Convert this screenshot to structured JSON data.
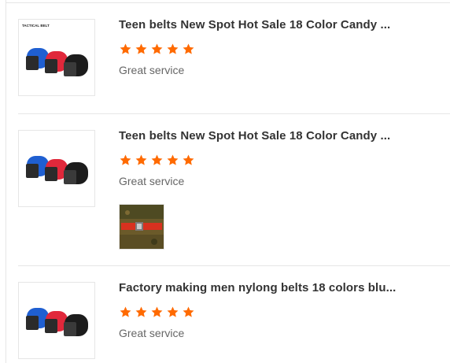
{
  "reviews": [
    {
      "title": "Teen belts New Spot Hot Sale 18 Color Candy ...",
      "rating": 5,
      "comment": "Great service",
      "thumb_caption": "TACTICAL BELT",
      "has_photo": false
    },
    {
      "title": "Teen belts New Spot Hot Sale 18 Color Candy ...",
      "rating": 5,
      "comment": "Great service",
      "has_photo": true
    },
    {
      "title": "Factory making men nylong belts 18 colors blu...",
      "rating": 5,
      "comment": "Great service",
      "has_photo": false
    }
  ],
  "colors": {
    "star": "#ff6a00",
    "title": "#333333",
    "comment": "#666666",
    "border": "#e6e6e6",
    "belt_blue": "#1f5fd1",
    "belt_red": "#e0283b",
    "belt_black": "#1c1c1c"
  }
}
